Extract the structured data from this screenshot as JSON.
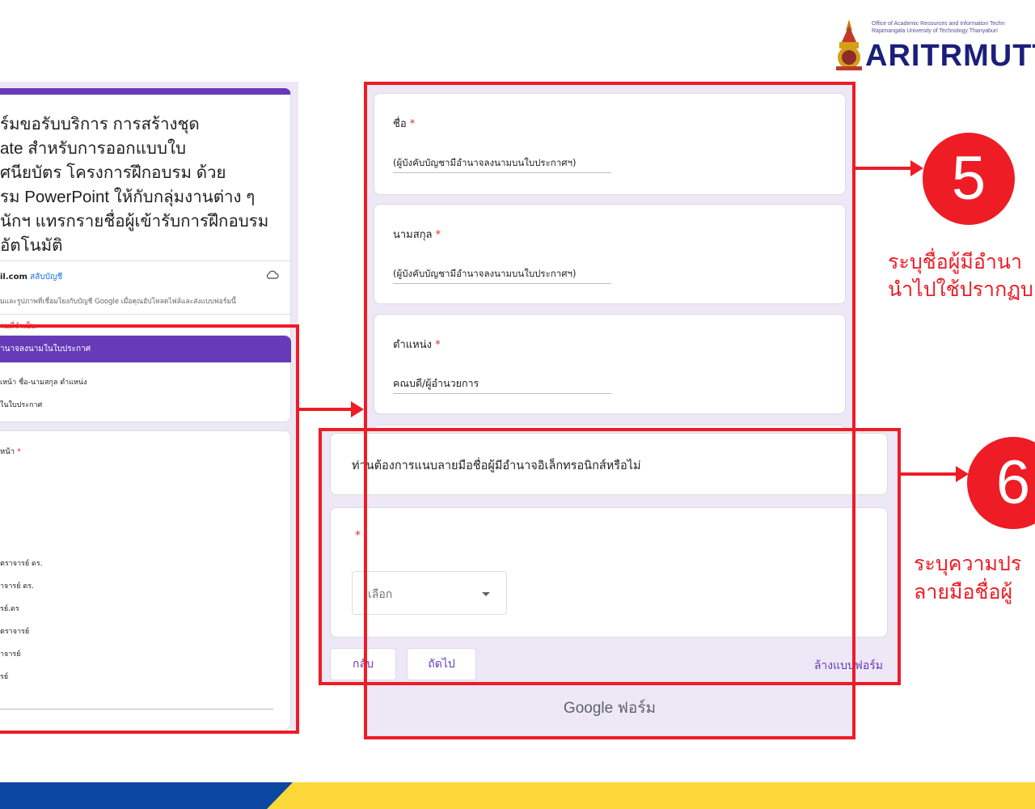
{
  "logo": {
    "line1": "Office of Academic Resources and Information Techn",
    "line2": "Rajamangala University of Technology Thanyaburi",
    "wordmark": "ARITRMUTT"
  },
  "left_form": {
    "title_lines": [
      "ร์มขอรับบริการ การสร้างชุด",
      "ate สำหรับการออกแบบใบ",
      "ศนียบัตร โครงการฝึกอบรม ด้วย",
      "รม PowerPoint ให้กับกลุ่มงานต่าง ๆ",
      "นักฯ แทรกรายชื่อผู้เข้ารับการฝึกอบรม",
      "อัตโนมัติ"
    ],
    "email": "il.com",
    "switch_account": "สลับบัญชี",
    "notice": "มและรูปภาพที่เชื่อมโยงกับบัญชี Google เมื่อคุณอัปโหลดไฟล์และส่งแบบฟอร์มนี้",
    "required_note": "ามที่จำเป็น",
    "section_title": "านาจลงนามในใบประกาศ",
    "section_desc1": "เหน้า ชื่อ-นามสกุล ตำแหน่ง",
    "section_desc2": "ในใบประกาศ",
    "question_label": "หน้า",
    "question_star": "*",
    "options": [
      "ตราจารย์ ดร.",
      "าจารย์ ดร.",
      "รย์.ดร",
      "ตราจารย์",
      "าจารย์",
      "รย์"
    ]
  },
  "main_form": {
    "fields": [
      {
        "label": "ชื่อ",
        "star": "*",
        "value": "(ผู้บังคับบัญชามีอำนาจลงนามบนใบประกาศฯ)"
      },
      {
        "label": "นามสกุล",
        "star": "*",
        "value": "(ผู้บังคับบัญชามีอำนาจลงนามบนใบประกาศฯ)"
      },
      {
        "label": "ตำแหน่ง",
        "star": "*",
        "value": "คณบดี/ผู้อำนวยการ"
      }
    ],
    "footer": "Google ฟอร์ม"
  },
  "popup": {
    "question_title": "ท่านต้องการแนบลายมือชื่อผู้มีอำนาจอิเล็กทรอนิกส์หรือไม่",
    "required_star": "*",
    "select_placeholder": "เลือก",
    "back_button": "กลับ",
    "next_button": "ถัดไป",
    "clear_form": "ล้างแบบฟอร์ม"
  },
  "annotations": {
    "step5": {
      "number": "5",
      "line1": "ระบุชื่อผู้มีอำนา",
      "line2": "นำไปใช้ปรากฏบ"
    },
    "step6": {
      "number": "6",
      "line1": "ระบุความปร",
      "line2": "ลายมือชื่อผู้"
    }
  },
  "colors": {
    "accent_red": "#ee1c25",
    "form_purple": "#673ab7",
    "form_bg": "#ede7f6",
    "bar_blue": "#0c47a1",
    "bar_yellow": "#fcd83b"
  }
}
